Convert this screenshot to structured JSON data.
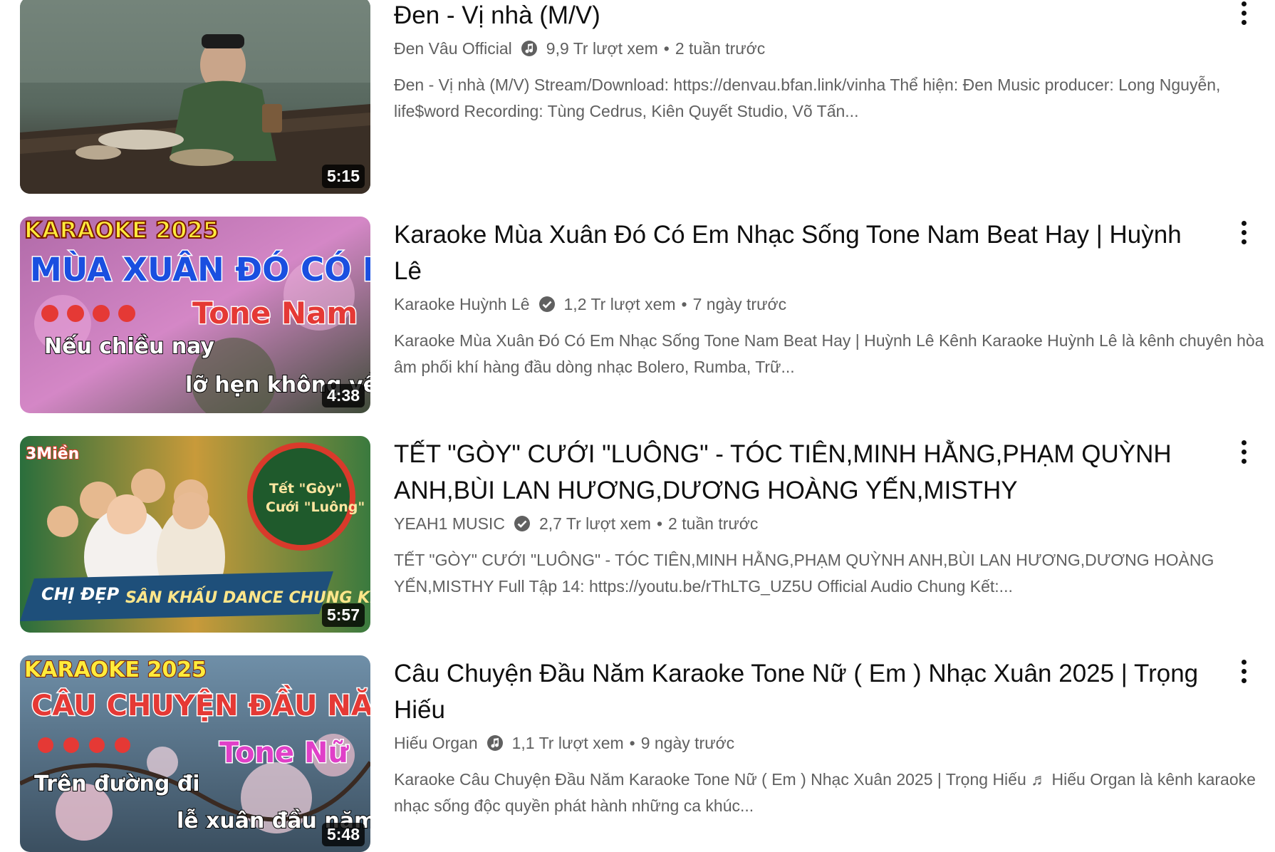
{
  "videos": [
    {
      "title": "Đen - Vị nhà (M/V)",
      "channel": "Đen Vâu Official",
      "verified_badge": "music-note-badge-icon",
      "views": "9,9 Tr lượt xem",
      "age": "2 tuần trước",
      "separator": "•",
      "description": "Đen - Vị nhà (M/V) Stream/Download: https://denvau.bfan.link/vinha Thể hiện: Đen Music producer: Long Nguyễn, life$word Recording: Tùng Cedrus, Kiên Quyết Studio, Võ Tấn...",
      "duration": "5:15"
    },
    {
      "title": "Karaoke Mùa Xuân Đó Có Em Nhạc Sống Tone Nam Beat Hay | Huỳnh Lê",
      "channel": "Karaoke Huỳnh Lê",
      "verified_badge": "verified-check-icon",
      "views": "1,2 Tr lượt xem",
      "age": "7 ngày trước",
      "separator": "•",
      "description": "Karaoke Mùa Xuân Đó Có Em Nhạc Sống Tone Nam Beat Hay | Huỳnh Lê Kênh Karaoke Huỳnh Lê là kênh chuyên hòa âm phối khí hàng đầu dòng nhạc Bolero, Rumba, Trữ...",
      "duration": "4:38",
      "thumb_text": {
        "top": "KARAOKE 2025",
        "main": "MÙA XUÂN ĐÓ CÓ EM",
        "tone": "Tone Nam",
        "line1": "Nếu chiều nay",
        "line2": "lỡ hẹn không về"
      }
    },
    {
      "title": "TẾT \"GÒY\" CƯỚI \"LUÔNG\" - TÓC TIÊN,MINH HẰNG,PHẠM QUỲNH ANH,BÙI LAN HƯƠNG,DƯƠNG HOÀNG YẾN,MISTHY",
      "channel": "YEAH1 MUSIC",
      "verified_badge": "verified-check-icon",
      "views": "2,7 Tr lượt xem",
      "age": "2 tuần trước",
      "separator": "•",
      "description": "TẾT \"GÒY\" CƯỚI \"LUÔNG\" - TÓC TIÊN,MINH HẰNG,PHẠM QUỲNH ANH,BÙI LAN HƯƠNG,DƯƠNG HOÀNG YẾN,MISTHY Full Tập 14: https://youtu.be/rThLTG_UZ5U Official Audio Chung Kết:...",
      "duration": "5:57",
      "thumb_text": {
        "logo": "3Miền",
        "badge_line1": "Tết \"Gòy\"",
        "badge_line2": "Cưới \"Luông\"",
        "show": "CHỊ ĐẸP",
        "banner": "SÂN KHẤU DANCE CHUNG KẾT"
      }
    },
    {
      "title": "Câu Chuyện Đầu Năm Karaoke Tone Nữ ( Em ) Nhạc Xuân 2025 | Trọng Hiếu",
      "channel": "Hiếu Organ",
      "verified_badge": "music-note-badge-icon",
      "views": "1,1 Tr lượt xem",
      "age": "9 ngày trước",
      "separator": "•",
      "description": "Karaoke Câu Chuyện Đầu Năm Karaoke Tone Nữ ( Em ) Nhạc Xuân 2025 | Trọng Hiếu ♬ Hiếu Organ là kênh karaoke nhạc sống độc quyền phát hành những ca khúc...",
      "duration": "5:48",
      "thumb_text": {
        "top": "KARAOKE 2025",
        "main": "CÂU CHUYỆN ĐẦU NĂM",
        "tone": "Tone Nữ",
        "line1": "Trên đường đi",
        "line2": "lễ xuân đầu năm"
      }
    }
  ],
  "more_icon": "more-vertical-icon",
  "colors": {
    "title": "#0f0f0f",
    "meta": "#606060",
    "duration_bg": "#000000"
  }
}
